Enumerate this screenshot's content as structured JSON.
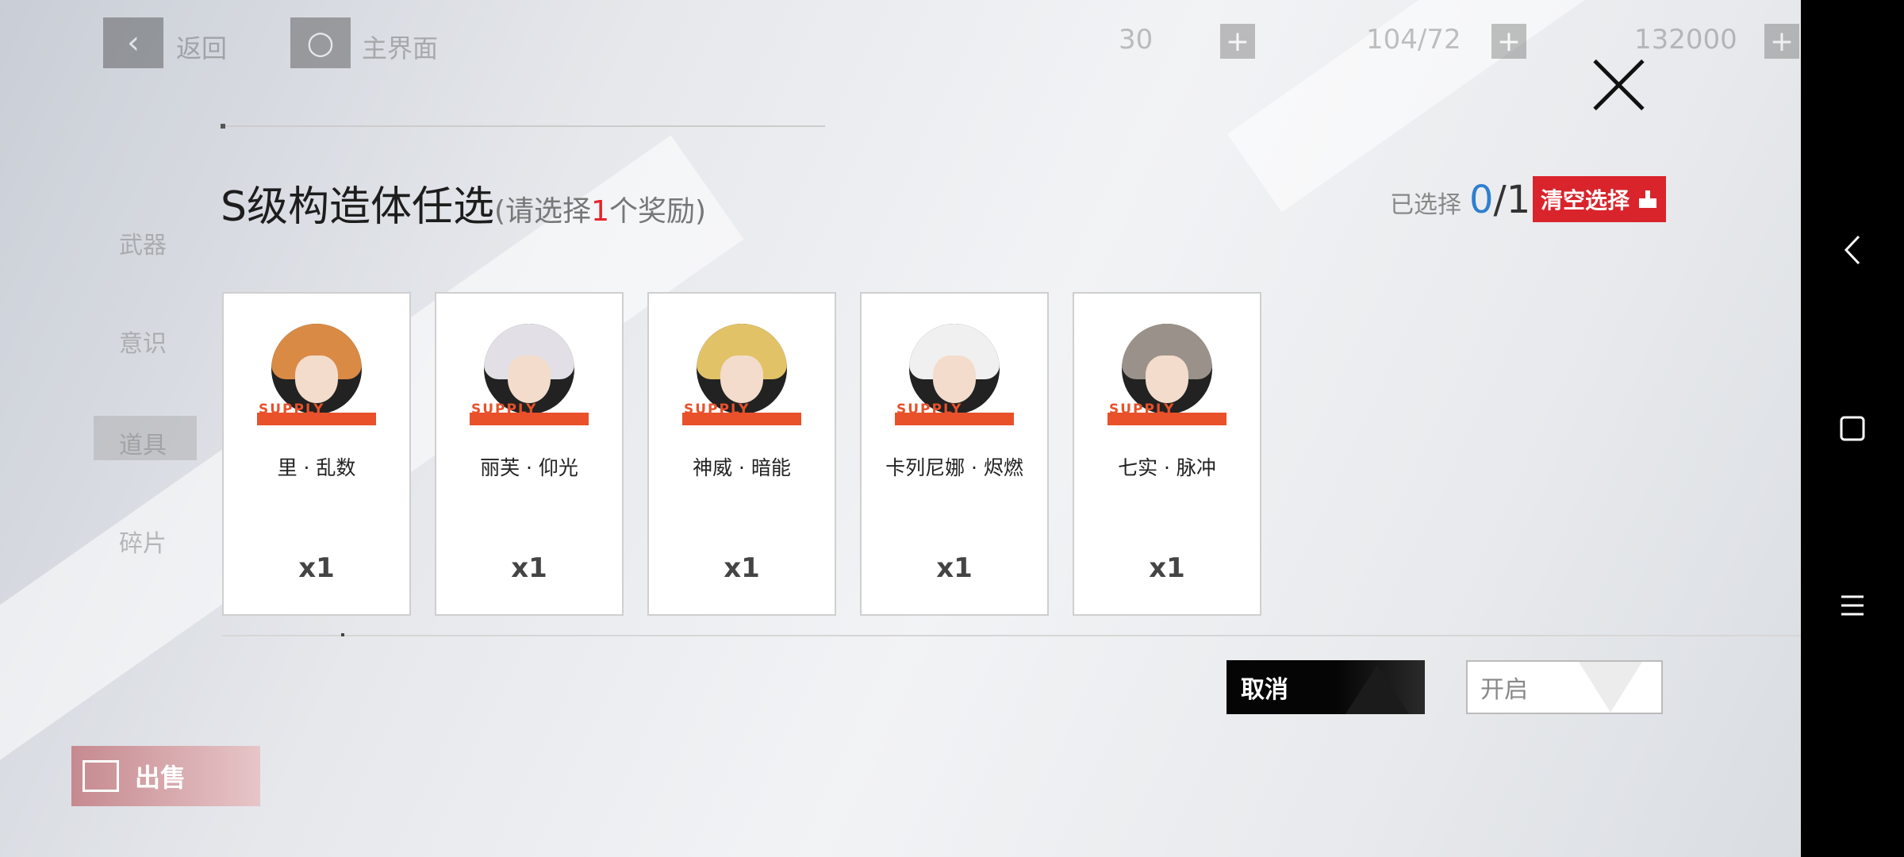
{
  "topbar": {
    "back_label": "返回",
    "home_label": "主界面",
    "resource1_value": "30",
    "resource2_value": "104/72",
    "resource3_value": "132000"
  },
  "sidebar": {
    "items": [
      {
        "label": "武器"
      },
      {
        "label": "意识"
      },
      {
        "label": "道具"
      },
      {
        "label": "碎片"
      }
    ]
  },
  "sell_button": {
    "label": "出售"
  },
  "dialog": {
    "title": "S级构造体任选",
    "subtitle_prefix": "(请选择",
    "subtitle_count": "1",
    "subtitle_suffix": "个奖励)",
    "selected_label": "已选择",
    "selected_current": "0",
    "selected_total": "/1",
    "clear_label": "清空选择",
    "supply_text": "SUPPLY",
    "stars": "★★★★★★",
    "options": [
      {
        "name": "里 · 乱数",
        "qty": "x1",
        "hair_color": "#d98a45"
      },
      {
        "name": "丽芙 · 仰光",
        "qty": "x1",
        "hair_color": "#e2e0e6"
      },
      {
        "name": "神威 · 暗能",
        "qty": "x1",
        "hair_color": "#e1c266"
      },
      {
        "name": "卡列尼娜 · 烬燃",
        "qty": "x1",
        "hair_color": "#f0f0f0"
      },
      {
        "name": "七实 · 脉冲",
        "qty": "x1",
        "hair_color": "#9a928a"
      }
    ],
    "cancel_label": "取消",
    "open_label": "开启"
  },
  "colors": {
    "accent_red": "#d9242c",
    "selected_blue": "#2e7fcf",
    "supply_orange": "#e8512a"
  }
}
